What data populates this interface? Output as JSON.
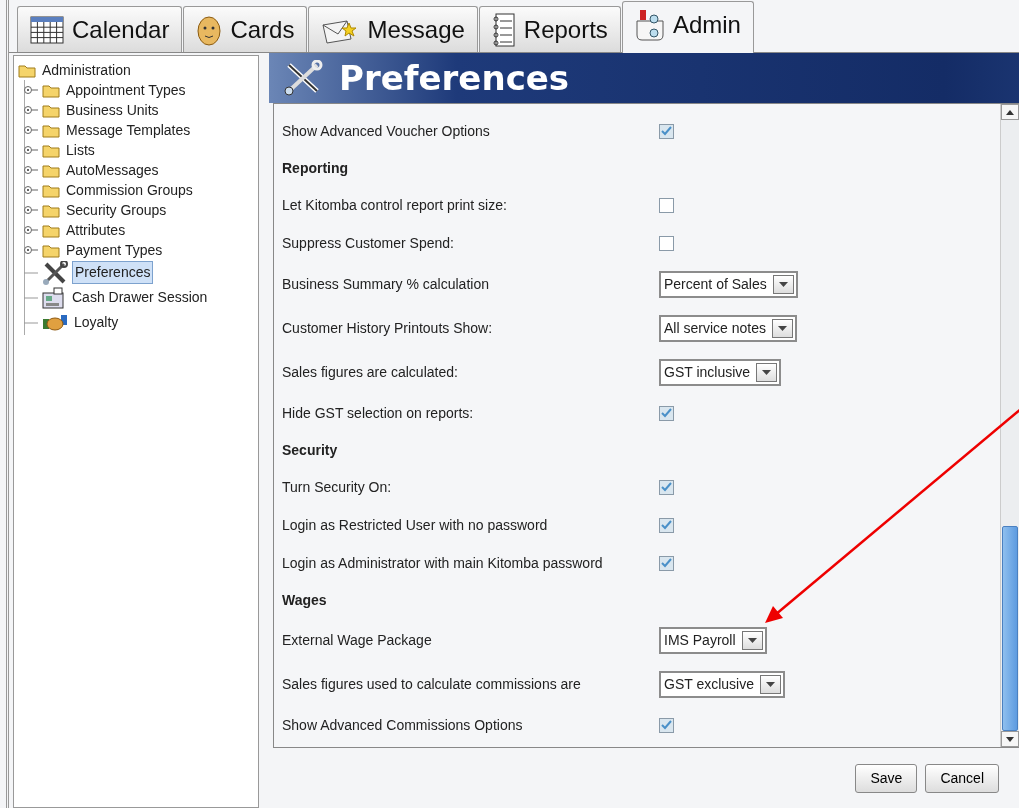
{
  "tabs": [
    {
      "label": "Calendar",
      "selected": false
    },
    {
      "label": "Cards",
      "selected": false
    },
    {
      "label": "Message",
      "selected": false
    },
    {
      "label": "Reports",
      "selected": false
    },
    {
      "label": "Admin",
      "selected": true
    }
  ],
  "tree": {
    "label": "Administration",
    "selected": false,
    "children": [
      {
        "label": "Appointment Types",
        "kind": "folder",
        "selected": false
      },
      {
        "label": "Business Units",
        "kind": "folder",
        "selected": false
      },
      {
        "label": "Message Templates",
        "kind": "folder",
        "selected": false
      },
      {
        "label": "Lists",
        "kind": "folder",
        "selected": false
      },
      {
        "label": "AutoMessages",
        "kind": "folder",
        "selected": false
      },
      {
        "label": "Commission Groups",
        "kind": "folder",
        "selected": false
      },
      {
        "label": "Security Groups",
        "kind": "folder",
        "selected": false
      },
      {
        "label": "Attributes",
        "kind": "folder",
        "selected": false
      },
      {
        "label": "Payment Types",
        "kind": "folder",
        "selected": false
      },
      {
        "label": "Preferences",
        "kind": "tools",
        "selected": true
      },
      {
        "label": "Cash Drawer Session",
        "kind": "register",
        "selected": false
      },
      {
        "label": "Loyalty",
        "kind": "handshake",
        "selected": false
      }
    ]
  },
  "panel_title": "Preferences",
  "settings": [
    {
      "kind": "checkbox",
      "label": "Show Advanced Voucher Options",
      "checked": true
    },
    {
      "kind": "heading",
      "label": "Reporting"
    },
    {
      "kind": "checkbox",
      "label": "Let Kitomba control report print size:",
      "checked": false
    },
    {
      "kind": "checkbox",
      "label": "Suppress Customer Spend:",
      "checked": false
    },
    {
      "kind": "select",
      "label": "Business Summary % calculation",
      "value": "Percent of Sales"
    },
    {
      "kind": "select",
      "label": "Customer History Printouts Show:",
      "value": "All service notes"
    },
    {
      "kind": "select",
      "label": "Sales figures are calculated:",
      "value": "GST inclusive"
    },
    {
      "kind": "checkbox",
      "label": "Hide GST selection on reports:",
      "checked": true
    },
    {
      "kind": "heading",
      "label": "Security"
    },
    {
      "kind": "checkbox",
      "label": "Turn Security On:",
      "checked": true
    },
    {
      "kind": "checkbox",
      "label": "Login as Restricted User with no password",
      "checked": true
    },
    {
      "kind": "checkbox",
      "label": "Login as Administrator with main Kitomba password",
      "checked": true
    },
    {
      "kind": "heading",
      "label": "Wages"
    },
    {
      "kind": "select",
      "label": "External Wage Package",
      "value": "IMS Payroll"
    },
    {
      "kind": "select",
      "label": "Sales figures used to calculate commissions are",
      "value": "GST exclusive"
    },
    {
      "kind": "checkbox",
      "label": "Show Advanced Commissions Options",
      "checked": true
    }
  ],
  "buttons": [
    "Save",
    "Cancel"
  ]
}
